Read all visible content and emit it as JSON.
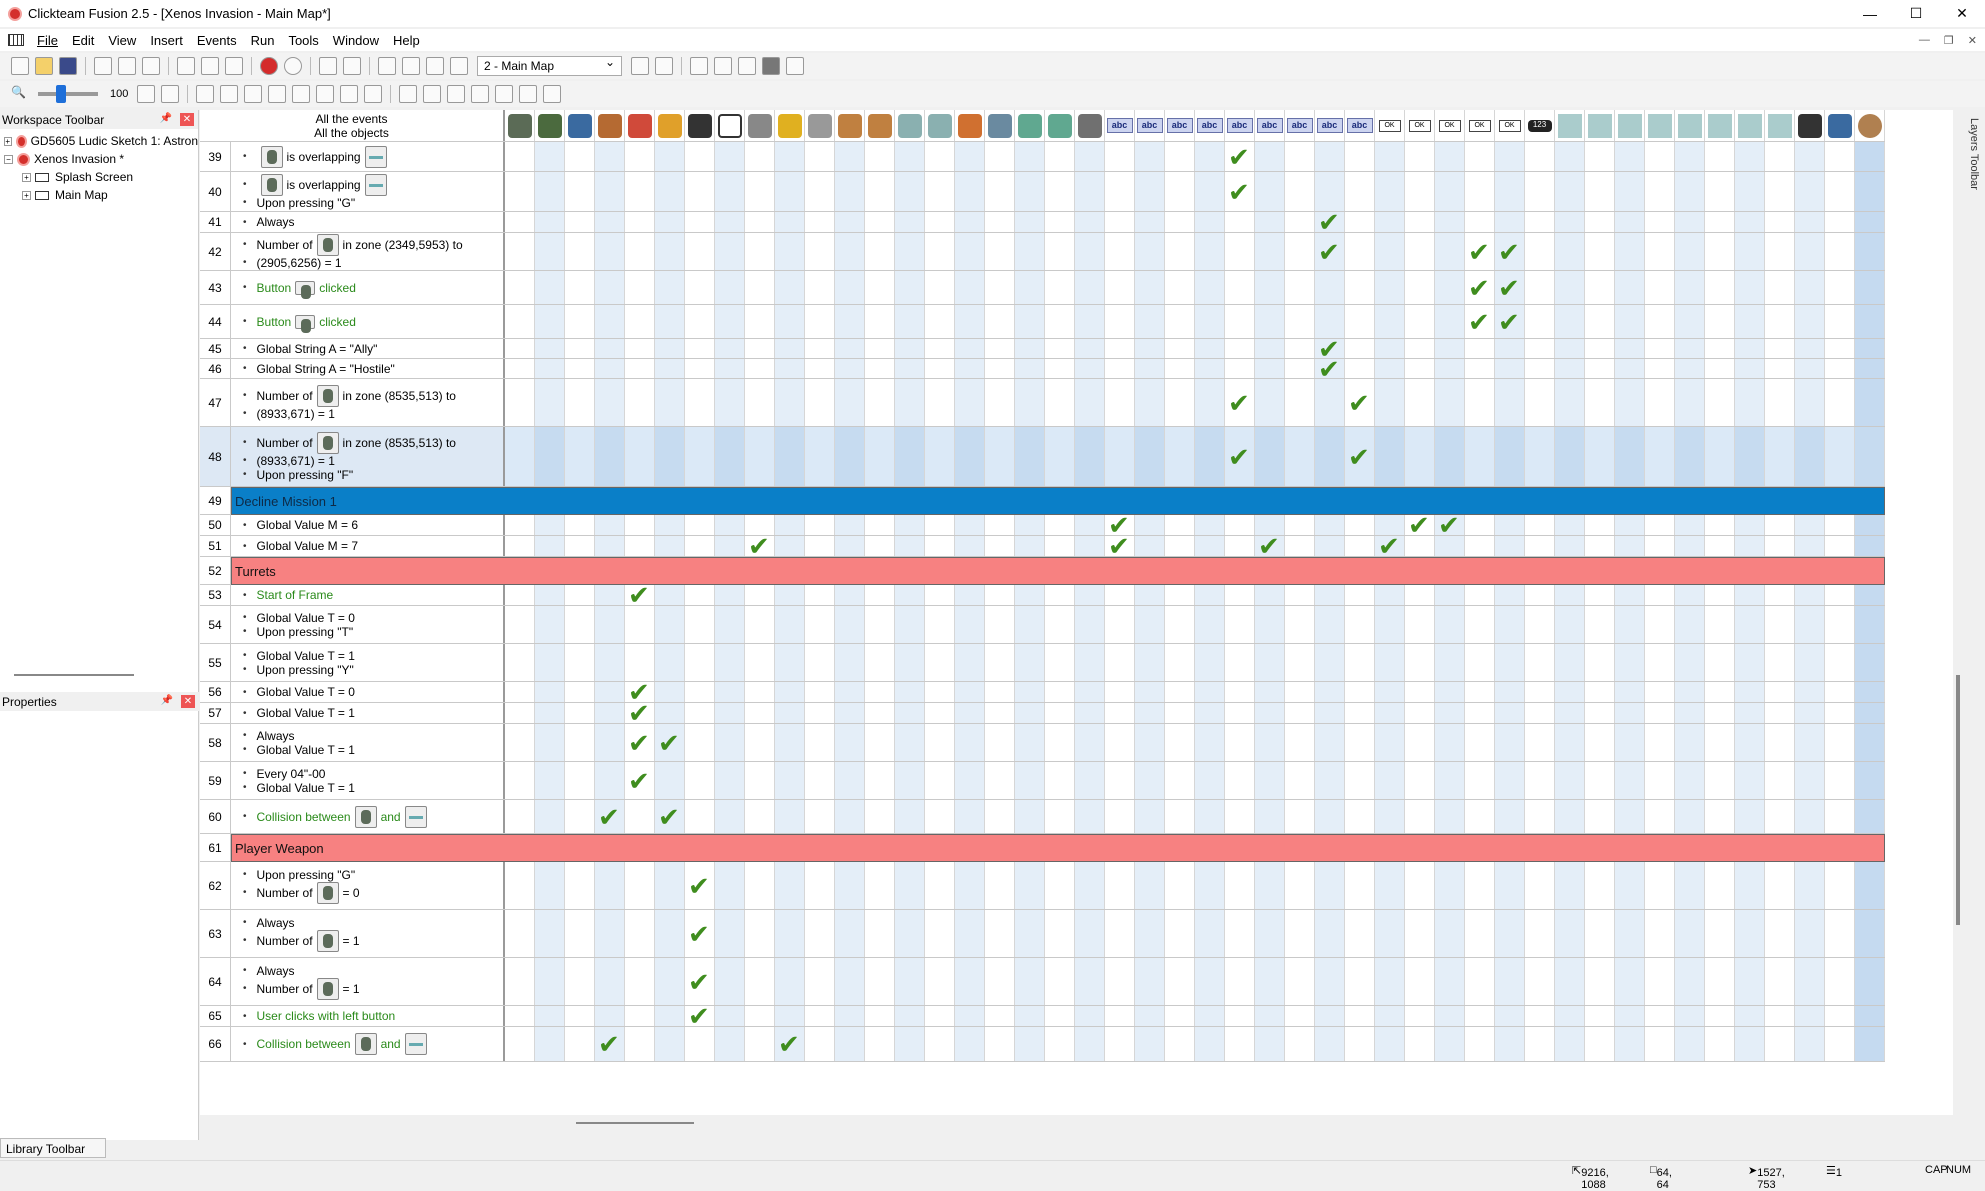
{
  "window": {
    "title": "Clickteam Fusion 2.5 - [Xenos Invasion - Main Map*]",
    "min": "—",
    "max": "☐",
    "close": "✕"
  },
  "menu": [
    "File",
    "Edit",
    "View",
    "Insert",
    "Events",
    "Run",
    "Tools",
    "Window",
    "Help"
  ],
  "toolbar": {
    "frame_select": "2 - Main Map",
    "zoom": "100"
  },
  "workspace": {
    "title": "Workspace Toolbar",
    "items": [
      "GD5605 Ludic Sketch 1: Astron",
      "Xenos Invasion *",
      "Splash Screen",
      "Main Map"
    ]
  },
  "properties": {
    "title": "Properties"
  },
  "editor": {
    "header_line1": "All the events",
    "header_line2": "All the objects"
  },
  "icons": {
    "abc": "abc",
    "ok": "OK",
    "counter": "123"
  },
  "events": [
    {
      "n": "39",
      "lines": [
        "[obj] is overlapping [obj2]"
      ],
      "checks": [
        24
      ]
    },
    {
      "n": "40",
      "lines": [
        "[obj] is overlapping [obj2]",
        "Upon pressing \"G\""
      ],
      "checks": [
        24
      ]
    },
    {
      "n": "41",
      "lines": [
        "Always"
      ],
      "checks": [
        27
      ]
    },
    {
      "n": "42",
      "lines": [
        "Number of [obj] in zone (2349,5953) to",
        "(2905,6256) = 1"
      ],
      "checks": [
        27,
        32,
        33
      ]
    },
    {
      "n": "43",
      "lines": [
        "Button [btn] clicked"
      ],
      "checks": [
        32,
        33
      ]
    },
    {
      "n": "44",
      "lines": [
        "Button [btn] clicked"
      ],
      "checks": [
        32,
        33
      ]
    },
    {
      "n": "45",
      "lines": [
        "Global String A = \"Ally\""
      ],
      "checks": [
        27
      ]
    },
    {
      "n": "46",
      "lines": [
        "Global String A = \"Hostile\""
      ],
      "checks": [
        27
      ]
    },
    {
      "n": "47",
      "lines": [
        "Number of [obj] in zone (8535,513) to",
        "(8933,671) = 1"
      ],
      "checks": [
        24,
        28
      ]
    },
    {
      "n": "48",
      "lines": [
        "Number of [obj] in zone (8535,513) to",
        "(8933,671) = 1",
        "Upon pressing \"F\""
      ],
      "checks": [
        24,
        28
      ]
    },
    {
      "n": "49",
      "group": "Decline Mission 1",
      "color": "blue"
    },
    {
      "n": "50",
      "lines": [
        "Global Value M = 6"
      ],
      "checks": [
        20,
        30,
        31
      ]
    },
    {
      "n": "51",
      "lines": [
        "Global Value M = 7"
      ],
      "checks": [
        8,
        20,
        25,
        29
      ]
    },
    {
      "n": "52",
      "group": "Turrets",
      "color": "red"
    },
    {
      "n": "53",
      "lines": [
        "Start of Frame"
      ],
      "checks": [
        4
      ]
    },
    {
      "n": "54",
      "lines": [
        "Global Value T = 0",
        "Upon pressing \"T\""
      ],
      "checks": []
    },
    {
      "n": "55",
      "lines": [
        "Global Value T = 1",
        "Upon pressing \"Y\""
      ],
      "checks": []
    },
    {
      "n": "56",
      "lines": [
        "Global Value T = 0"
      ],
      "checks": [
        4
      ]
    },
    {
      "n": "57",
      "lines": [
        "Global Value T = 1"
      ],
      "checks": [
        4
      ]
    },
    {
      "n": "58",
      "lines": [
        "Always",
        "Global Value T = 1"
      ],
      "checks": [
        4,
        5
      ]
    },
    {
      "n": "59",
      "lines": [
        "Every 04\"-00",
        "Global Value T = 1"
      ],
      "checks": [
        4
      ]
    },
    {
      "n": "60",
      "lines": [
        "Collision between [obj] and [obj2]"
      ],
      "checks": [
        3,
        5
      ]
    },
    {
      "n": "61",
      "group": "Player Weapon",
      "color": "red"
    },
    {
      "n": "62",
      "lines": [
        "Upon pressing \"G\"",
        "Number of [obj] = 0"
      ],
      "checks": [
        6
      ]
    },
    {
      "n": "63",
      "lines": [
        "Always",
        "Number of [obj] = 1"
      ],
      "checks": [
        6
      ]
    },
    {
      "n": "64",
      "lines": [
        "Always",
        "Number of [obj] = 1"
      ],
      "checks": [
        6
      ]
    },
    {
      "n": "65",
      "lines": [
        "User clicks with left button"
      ],
      "checks": [
        6
      ]
    },
    {
      "n": "66",
      "lines": [
        "Collision between [obj] and [obj2]"
      ],
      "checks": [
        3,
        9
      ]
    }
  ],
  "text": {
    "is_overlapping": "is overlapping",
    "upon_g": "Upon pressing \"G\"",
    "always": "Always",
    "number_of": "Number of",
    "zone1a": "in zone (2349,5953) to",
    "zone1b": "(2905,6256) = 1",
    "button": "Button",
    "clicked": "clicked",
    "gs_ally": "Global String A = \"Ally\"",
    "gs_hostile": "Global String A = \"Hostile\"",
    "zone2a": "in zone (8535,513) to",
    "zone2b": "(8933,671) = 1",
    "upon_f": "Upon pressing \"F\"",
    "decline": "Decline Mission 1",
    "gvm6": "Global Value M = 6",
    "gvm7": "Global Value M = 7",
    "turrets": "Turrets",
    "start_frame": "Start of Frame",
    "gvt0": "Global Value T = 0",
    "gvt1": "Global Value T = 1",
    "upon_t": "Upon pressing \"T\"",
    "upon_y": "Upon pressing \"Y\"",
    "every": "Every 04\"-00",
    "collision": "Collision between",
    "and": "and",
    "player_weapon": "Player Weapon",
    "eq0": "= 0",
    "eq1": "= 1",
    "user_clicks": "User clicks with left button"
  },
  "layers_toolbar": "Layers Toolbar",
  "library_toolbar": "Library Toolbar",
  "status": {
    "pos": "9216, 1088",
    "size": "64, 64",
    "cursor": "1527, 753",
    "layer": "1",
    "caps": "CAP",
    "num": "NUM"
  },
  "colors": {
    "group_blue": "#0a7fc8",
    "group_red": "#f78181",
    "check": "#3f8d1e",
    "condition_green": "#2a8a1a"
  }
}
